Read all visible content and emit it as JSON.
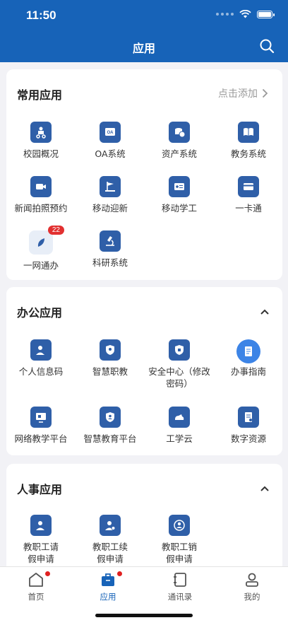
{
  "status": {
    "time": "11:50"
  },
  "header": {
    "title": "应用"
  },
  "common": {
    "title": "常用应用",
    "add_label": "点击添加",
    "items": [
      {
        "label": "校园概况",
        "icon": "campus-icon"
      },
      {
        "label": "OA系统",
        "icon": "oa-icon"
      },
      {
        "label": "资产系统",
        "icon": "assets-icon"
      },
      {
        "label": "教务系统",
        "icon": "book-icon"
      },
      {
        "label": "新闻拍照预约",
        "icon": "camera-icon"
      },
      {
        "label": "移动迎新",
        "icon": "flag-icon"
      },
      {
        "label": "移动学工",
        "icon": "id-card-icon"
      },
      {
        "label": "一卡通",
        "icon": "card-icon"
      },
      {
        "label": "一网通办",
        "icon": "leaf-icon",
        "badge": "22"
      },
      {
        "label": "科研系统",
        "icon": "microscope-icon"
      }
    ]
  },
  "office": {
    "title": "办公应用",
    "items": [
      {
        "label": "个人信息码",
        "icon": "person-icon"
      },
      {
        "label": "智慧职教",
        "icon": "shield-icon"
      },
      {
        "label": "安全中心（修改密码）",
        "icon": "security-shield-icon"
      },
      {
        "label": "办事指南",
        "icon": "guide-book-icon"
      },
      {
        "label": "网络教学平台",
        "icon": "monitor-icon"
      },
      {
        "label": "智慧教育平台",
        "icon": "education-shield-icon"
      },
      {
        "label": "工学云",
        "icon": "cloud-rhino-icon"
      },
      {
        "label": "数字资源",
        "icon": "document-icon"
      }
    ]
  },
  "hr": {
    "title": "人事应用",
    "items": [
      {
        "label": "教职工请假申请",
        "icon": "leave-request-icon"
      },
      {
        "label": "教职工续假申请",
        "icon": "leave-extend-icon"
      },
      {
        "label": "教职工销假申请",
        "icon": "leave-cancel-icon"
      }
    ]
  },
  "tabbar": {
    "items": [
      {
        "label": "首页",
        "icon": "home-icon"
      },
      {
        "label": "应用",
        "icon": "briefcase-icon"
      },
      {
        "label": "通讯录",
        "icon": "contacts-icon"
      },
      {
        "label": "我的",
        "icon": "profile-icon"
      }
    ]
  },
  "colors": {
    "primary": "#1763b8",
    "icon_bg": "#2f5fa8",
    "badge": "#e23030",
    "background": "#f2f2f6"
  }
}
